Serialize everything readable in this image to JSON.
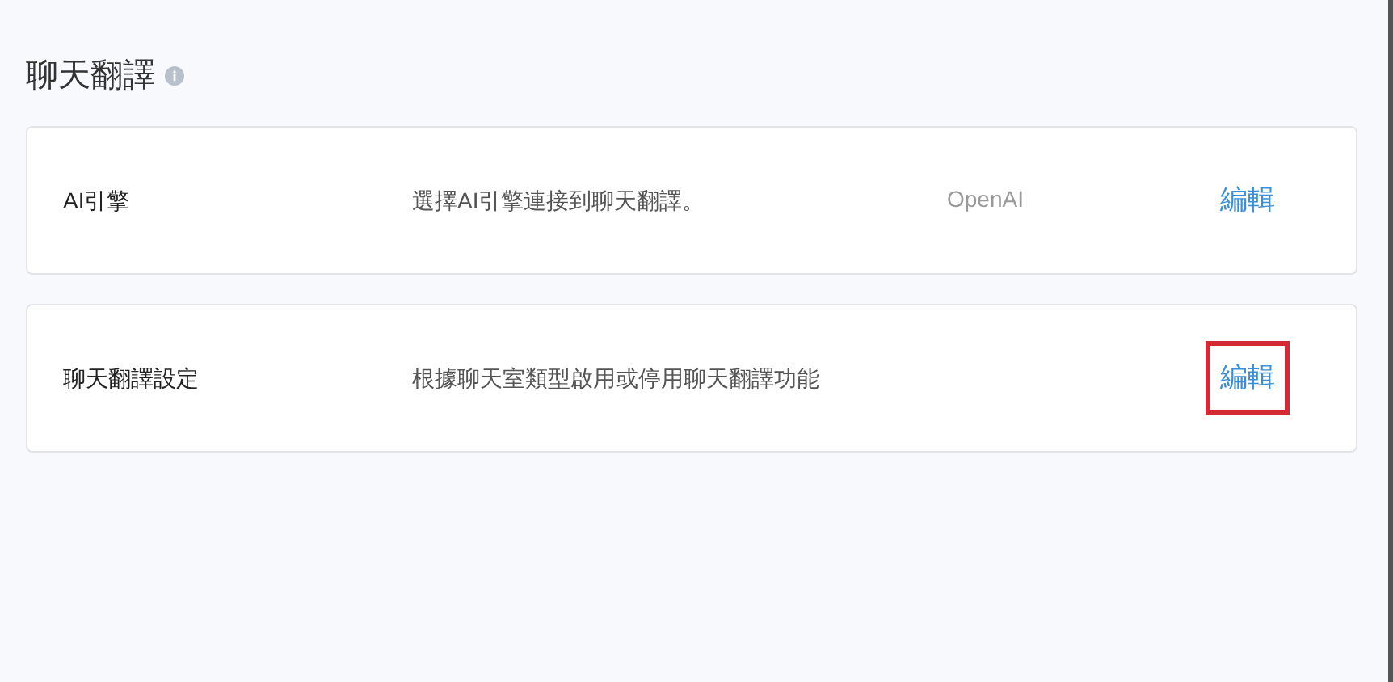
{
  "section": {
    "title": "聊天翻譯"
  },
  "settings": [
    {
      "label": "AI引擎",
      "description": "選擇AI引擎連接到聊天翻譯。",
      "value": "OpenAI",
      "action": "編輯",
      "highlighted": false
    },
    {
      "label": "聊天翻譯設定",
      "description": "根據聊天室類型啟用或停用聊天翻譯功能",
      "action": "編輯",
      "highlighted": true
    }
  ]
}
